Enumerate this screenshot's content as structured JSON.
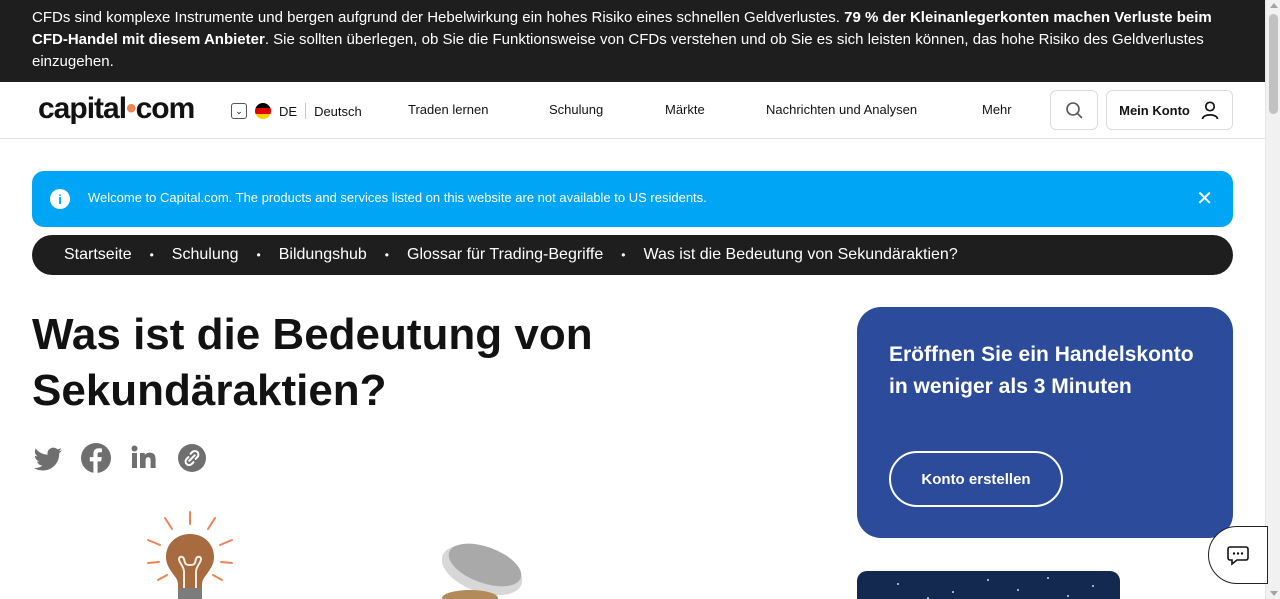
{
  "risk_warning": {
    "part1": "CFDs sind komplexe Instrumente und bergen aufgrund der Hebelwirkung ein hohes Risiko eines schnellen Geldverlustes. ",
    "bold": "79 % der Kleinanlegerkonten machen Verluste beim CFD-Handel mit diesem Anbieter",
    "part2": ". Sie sollten überlegen, ob Sie die Funktionsweise von CFDs verstehen und ob Sie es sich leisten können, das hohe Risiko des Geldverlustes einzugehen."
  },
  "header": {
    "logo_left": "capital",
    "logo_dot": "•",
    "logo_right": "com",
    "lang_code": "DE",
    "lang_name": "Deutsch",
    "nav": [
      "Traden lernen",
      "Schulung",
      "Märkte",
      "Nachrichten und Analysen",
      "Mehr"
    ],
    "account_label": "Mein Konto"
  },
  "info_banner": {
    "text": "Welcome to Capital.com. The products and services listed on this website are not available to US residents.",
    "icon": "info-icon",
    "close_icon": "close-icon"
  },
  "breadcrumb": [
    "Startseite",
    "Schulung",
    "Bildungshub",
    "Glossar für Trading-Begriffe",
    "Was ist die Bedeutung von Sekundäraktien?"
  ],
  "page": {
    "title_line1": "Was ist die Bedeutung von",
    "title_line2": "Sekundäraktien?"
  },
  "share_icons": [
    "twitter-icon",
    "facebook-icon",
    "linkedin-icon",
    "copy-link-icon"
  ],
  "promo": {
    "title": "Eröffnen Sie ein Handelskonto in weniger als 3 Minuten",
    "button": "Konto erstellen"
  },
  "colors": {
    "risk_bg": "#1e1e1e",
    "info_banner": "#00a6f5",
    "promo_bg": "#2c4b9b",
    "accent": "#ef8354",
    "icon_gray": "#6f6f6f"
  }
}
